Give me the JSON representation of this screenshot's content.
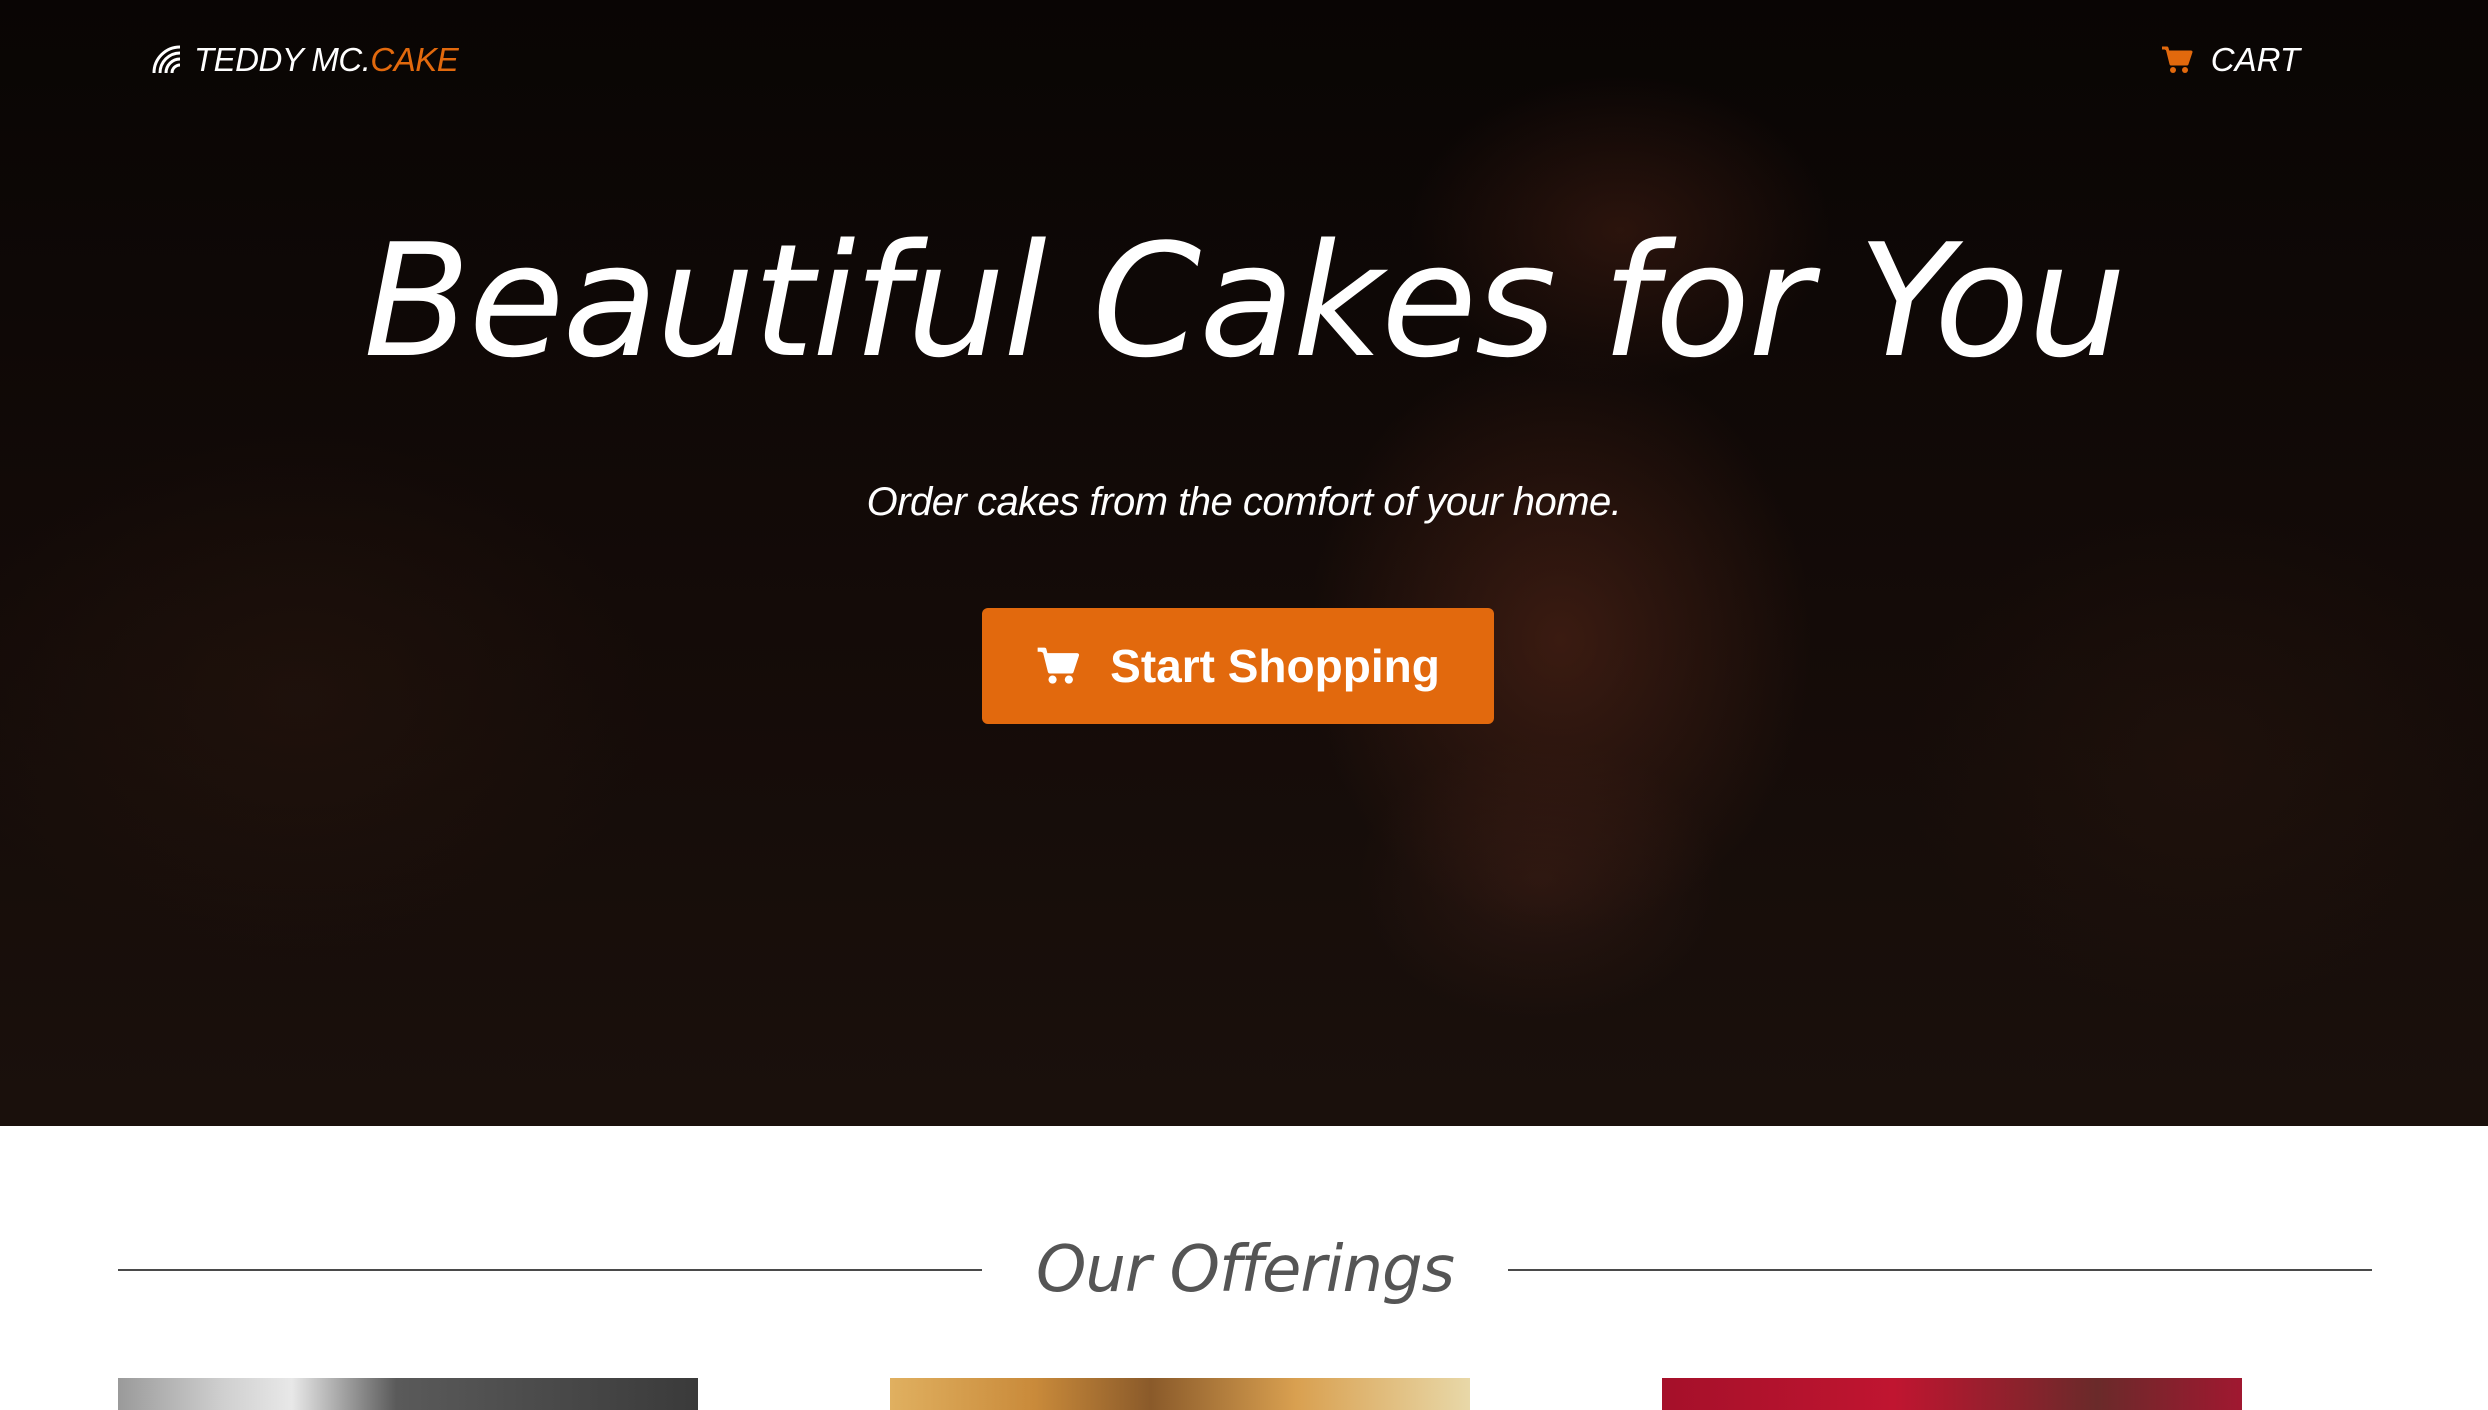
{
  "nav": {
    "brand_main": "TEDDY MC.",
    "brand_accent": "CAKE",
    "cart_label": "CART"
  },
  "hero": {
    "title": "Beautiful Cakes for You",
    "subtitle": "Order cakes from the comfort of your home.",
    "cta_label": "Start Shopping"
  },
  "offerings": {
    "title": "Our Offerings"
  },
  "colors": {
    "accent": "#e2690d",
    "hero_bg": "#0c0706"
  },
  "icons": {
    "brand": "signal-waves-icon",
    "cart": "shopping-cart-icon"
  }
}
